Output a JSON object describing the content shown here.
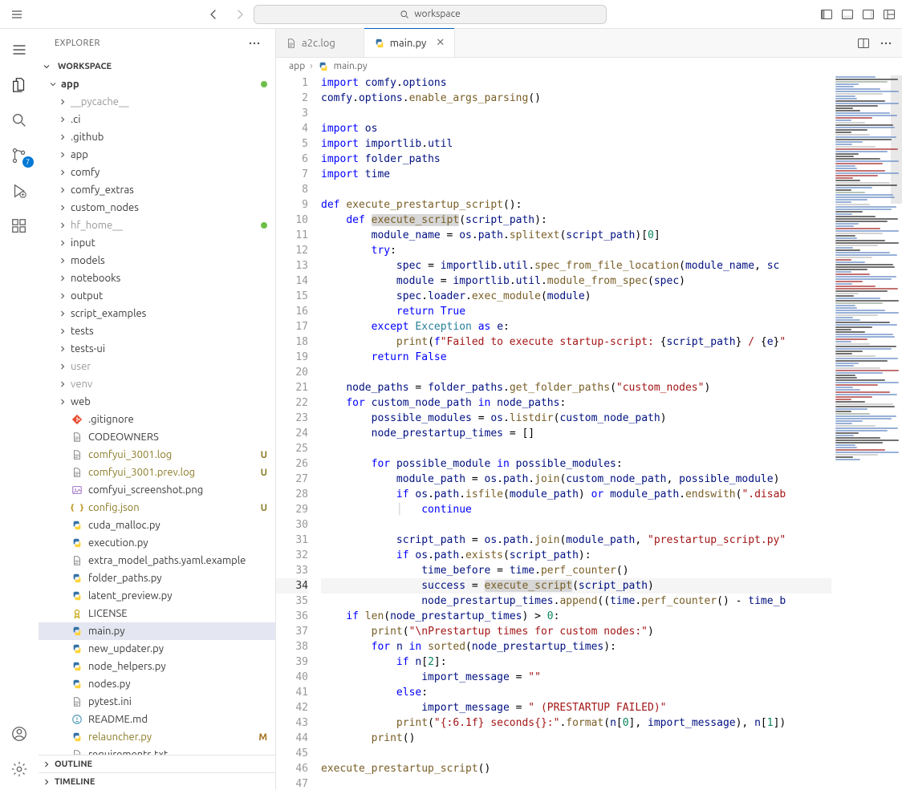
{
  "titlebar": {
    "search_placeholder": "workspace"
  },
  "activity": {
    "scm_badge": "7"
  },
  "sidebar": {
    "title": "EXPLORER",
    "workspace_label": "WORKSPACE",
    "root_label": "app",
    "outline_label": "OUTLINE",
    "timeline_label": "TIMELINE",
    "folders": [
      {
        "label": "__pycache__",
        "muted": true
      },
      {
        "label": ".ci"
      },
      {
        "label": ".github"
      },
      {
        "label": "app"
      },
      {
        "label": "comfy"
      },
      {
        "label": "comfy_extras"
      },
      {
        "label": "custom_nodes"
      },
      {
        "label": "hf_home__",
        "dot": true,
        "muted": true
      },
      {
        "label": "input"
      },
      {
        "label": "models"
      },
      {
        "label": "notebooks"
      },
      {
        "label": "output"
      },
      {
        "label": "script_examples"
      },
      {
        "label": "tests"
      },
      {
        "label": "tests-ui"
      },
      {
        "label": "user",
        "muted": true
      },
      {
        "label": "venv",
        "muted": true
      },
      {
        "label": "web"
      }
    ],
    "files": [
      {
        "label": ".gitignore",
        "icon": "git"
      },
      {
        "label": "CODEOWNERS",
        "icon": "txt"
      },
      {
        "label": "comfyui_3001.log",
        "icon": "txt",
        "status": "U",
        "olive": true
      },
      {
        "label": "comfyui_3001.prev.log",
        "icon": "txt",
        "status": "U",
        "olive": true
      },
      {
        "label": "comfyui_screenshot.png",
        "icon": "img"
      },
      {
        "label": "config.json",
        "icon": "json",
        "status": "U",
        "olive": true
      },
      {
        "label": "cuda_malloc.py",
        "icon": "py"
      },
      {
        "label": "execution.py",
        "icon": "py"
      },
      {
        "label": "extra_model_paths.yaml.example",
        "icon": "txt"
      },
      {
        "label": "folder_paths.py",
        "icon": "py"
      },
      {
        "label": "latent_preview.py",
        "icon": "py"
      },
      {
        "label": "LICENSE",
        "icon": "lic"
      },
      {
        "label": "main.py",
        "icon": "py",
        "selected": true
      },
      {
        "label": "new_updater.py",
        "icon": "py"
      },
      {
        "label": "node_helpers.py",
        "icon": "py"
      },
      {
        "label": "nodes.py",
        "icon": "py"
      },
      {
        "label": "pytest.ini",
        "icon": "txt"
      },
      {
        "label": "README.md",
        "icon": "md"
      },
      {
        "label": "relauncher.py",
        "icon": "py",
        "status": "M",
        "olive": true,
        "mstatus": true
      },
      {
        "label": "requirements.txt",
        "icon": "txt"
      }
    ]
  },
  "tabs": [
    {
      "label": "a2c.log",
      "icon": "txt",
      "active": false
    },
    {
      "label": "main.py",
      "icon": "py",
      "active": true
    }
  ],
  "breadcrumbs": [
    "app",
    "main.py"
  ],
  "current_line": 34,
  "code": [
    {
      "n": 1,
      "h": "<span class='kw'>import</span> <span class='id'>comfy</span>.<span class='id'>options</span>"
    },
    {
      "n": 2,
      "h": "<span class='id'>comfy</span>.<span class='id'>options</span>.<span class='fn'>enable_args_parsing</span><span class='op'>()</span>"
    },
    {
      "n": 3,
      "h": ""
    },
    {
      "n": 4,
      "h": "<span class='kw'>import</span> <span class='id'>os</span>"
    },
    {
      "n": 5,
      "h": "<span class='kw'>import</span> <span class='id'>importlib</span>.<span class='id'>util</span>"
    },
    {
      "n": 6,
      "h": "<span class='kw'>import</span> <span class='id'>folder_paths</span>"
    },
    {
      "n": 7,
      "h": "<span class='kw'>import</span> <span class='id'>time</span>"
    },
    {
      "n": 8,
      "h": ""
    },
    {
      "n": 9,
      "h": "<span class='kw'>def</span> <span class='dn'>execute_prestartup_script</span><span class='op'>():</span>"
    },
    {
      "n": 10,
      "h": "    <span class='kw'>def</span> <span class='dn hl'>execute_script</span><span class='op'>(</span><span class='id'>script_path</span><span class='op'>):</span>"
    },
    {
      "n": 11,
      "h": "        <span class='id'>module_name</span> <span class='op'>=</span> <span class='id'>os</span>.<span class='id'>path</span>.<span class='fn'>splitext</span><span class='op'>(</span><span class='id'>script_path</span><span class='op'>)[</span><span class='nm'>0</span><span class='op'>]</span>"
    },
    {
      "n": 12,
      "h": "        <span class='kw'>try</span><span class='op'>:</span>"
    },
    {
      "n": 13,
      "h": "            <span class='id'>spec</span> <span class='op'>=</span> <span class='id'>importlib</span>.<span class='id'>util</span>.<span class='fn'>spec_from_file_location</span><span class='op'>(</span><span class='id'>module_name</span><span class='op'>,</span> <span class='id'>sc</span>"
    },
    {
      "n": 14,
      "h": "            <span class='id'>module</span> <span class='op'>=</span> <span class='id'>importlib</span>.<span class='id'>util</span>.<span class='fn'>module_from_spec</span><span class='op'>(</span><span class='id'>spec</span><span class='op'>)</span>"
    },
    {
      "n": 15,
      "h": "            <span class='id'>spec</span>.<span class='id'>loader</span>.<span class='fn'>exec_module</span><span class='op'>(</span><span class='id'>module</span><span class='op'>)</span>"
    },
    {
      "n": 16,
      "h": "            <span class='kw'>return</span> <span class='bl'>True</span>"
    },
    {
      "n": 17,
      "h": "        <span class='kw'>except</span> <span class='df'>Exception</span> <span class='kw'>as</span> <span class='id'>e</span><span class='op'>:</span>"
    },
    {
      "n": 18,
      "h": "            <span class='fn'>print</span><span class='op'>(</span><span class='kw'>f</span><span class='st'>\"Failed to execute startup-script: </span><span class='op'>{</span><span class='id'>script_path</span><span class='op'>}</span><span class='st'> / </span><span class='op'>{</span><span class='id'>e</span><span class='op'>}</span><span class='st'>\"</span>"
    },
    {
      "n": 19,
      "h": "        <span class='kw'>return</span> <span class='bl'>False</span>"
    },
    {
      "n": 20,
      "h": ""
    },
    {
      "n": 21,
      "h": "    <span class='id'>node_paths</span> <span class='op'>=</span> <span class='id'>folder_paths</span>.<span class='fn'>get_folder_paths</span><span class='op'>(</span><span class='st'>\"custom_nodes\"</span><span class='op'>)</span>"
    },
    {
      "n": 22,
      "h": "    <span class='kw'>for</span> <span class='id'>custom_node_path</span> <span class='kw'>in</span> <span class='id'>node_paths</span><span class='op'>:</span>"
    },
    {
      "n": 23,
      "h": "        <span class='id'>possible_modules</span> <span class='op'>=</span> <span class='id'>os</span>.<span class='fn'>listdir</span><span class='op'>(</span><span class='id'>custom_node_path</span><span class='op'>)</span>"
    },
    {
      "n": 24,
      "h": "        <span class='id'>node_prestartup_times</span> <span class='op'>=</span> <span class='op'>[]</span>"
    },
    {
      "n": 25,
      "h": ""
    },
    {
      "n": 26,
      "h": "        <span class='kw'>for</span> <span class='id'>possible_module</span> <span class='kw'>in</span> <span class='id'>possible_modules</span><span class='op'>:</span>"
    },
    {
      "n": 27,
      "h": "            <span class='id'>module_path</span> <span class='op'>=</span> <span class='id'>os</span>.<span class='id'>path</span>.<span class='fn'>join</span><span class='op'>(</span><span class='id'>custom_node_path</span><span class='op'>,</span> <span class='id'>possible_module</span><span class='op'>)</span>"
    },
    {
      "n": 28,
      "h": "            <span class='kw'>if</span> <span class='id'>os</span>.<span class='id'>path</span>.<span class='fn'>isfile</span><span class='op'>(</span><span class='id'>module_path</span><span class='op'>)</span> <span class='kw'>or</span> <span class='id'>module_path</span>.<span class='fn'>endswith</span><span class='op'>(</span><span class='st'>\".disab</span>"
    },
    {
      "n": 29,
      "h": "            <span class='indent'>│</span>   <span class='kw'>continue</span>"
    },
    {
      "n": 30,
      "h": ""
    },
    {
      "n": 31,
      "h": "            <span class='id'>script_path</span> <span class='op'>=</span> <span class='id'>os</span>.<span class='id'>path</span>.<span class='fn'>join</span><span class='op'>(</span><span class='id'>module_path</span><span class='op'>,</span> <span class='st'>\"prestartup_script.py\"</span>"
    },
    {
      "n": 32,
      "h": "            <span class='kw'>if</span> <span class='id'>os</span>.<span class='id'>path</span>.<span class='fn'>exists</span><span class='op'>(</span><span class='id'>script_path</span><span class='op'>):</span>"
    },
    {
      "n": 33,
      "h": "                <span class='id'>time_before</span> <span class='op'>=</span> <span class='id'>time</span>.<span class='fn'>perf_counter</span><span class='op'>()</span>"
    },
    {
      "n": 34,
      "h": "                <span class='id'>success</span> <span class='op'>=</span> <span class='fn hl'>execute_script</span><span class='op'>(</span><span class='id'>script_path</span><span class='op'>)</span>"
    },
    {
      "n": 35,
      "h": "                <span class='id'>node_prestartup_times</span>.<span class='fn'>append</span><span class='op'>((</span><span class='id'>time</span>.<span class='fn'>perf_counter</span><span class='op'>()</span> <span class='op'>-</span> <span class='id'>time_b</span>"
    },
    {
      "n": 36,
      "h": "    <span class='kw'>if</span> <span class='fn'>len</span><span class='op'>(</span><span class='id'>node_prestartup_times</span><span class='op'>)</span> <span class='op'>&gt;</span> <span class='nm'>0</span><span class='op'>:</span>"
    },
    {
      "n": 37,
      "h": "        <span class='fn'>print</span><span class='op'>(</span><span class='st'>\"\\nPrestartup times for custom nodes:\"</span><span class='op'>)</span>"
    },
    {
      "n": 38,
      "h": "        <span class='kw'>for</span> <span class='id'>n</span> <span class='kw'>in</span> <span class='fn'>sorted</span><span class='op'>(</span><span class='id'>node_prestartup_times</span><span class='op'>):</span>"
    },
    {
      "n": 39,
      "h": "            <span class='kw'>if</span> <span class='id'>n</span><span class='op'>[</span><span class='nm'>2</span><span class='op'>]:</span>"
    },
    {
      "n": 40,
      "h": "                <span class='id'>import_message</span> <span class='op'>=</span> <span class='st'>\"\"</span>"
    },
    {
      "n": 41,
      "h": "            <span class='kw'>else</span><span class='op'>:</span>"
    },
    {
      "n": 42,
      "h": "                <span class='id'>import_message</span> <span class='op'>=</span> <span class='st'>\" (PRESTARTUP FAILED)\"</span>"
    },
    {
      "n": 43,
      "h": "            <span class='fn'>print</span><span class='op'>(</span><span class='st'>\"{:6.1f} seconds{}:\"</span>.<span class='fn'>format</span><span class='op'>(</span><span class='id'>n</span><span class='op'>[</span><span class='nm'>0</span><span class='op'>],</span> <span class='id'>import_message</span><span class='op'>),</span> <span class='id'>n</span><span class='op'>[</span><span class='nm'>1</span><span class='op'>])</span>"
    },
    {
      "n": 44,
      "h": "        <span class='fn'>print</span><span class='op'>()</span>"
    },
    {
      "n": 45,
      "h": ""
    },
    {
      "n": 46,
      "h": "<span class='fn'>execute_prestartup_script</span><span class='op'>()</span>"
    },
    {
      "n": 47,
      "h": ""
    }
  ]
}
